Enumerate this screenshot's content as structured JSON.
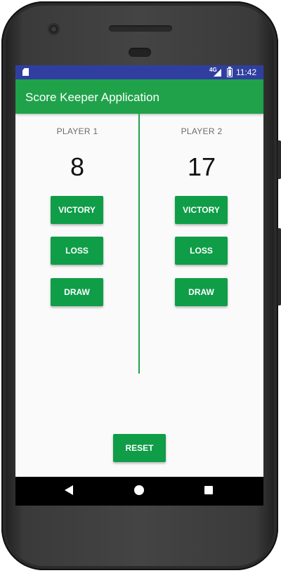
{
  "status_bar": {
    "network_label": "4G",
    "time": "11:42",
    "icons": [
      "sd-card-icon",
      "signal-icon",
      "battery-icon"
    ]
  },
  "app_bar": {
    "title": "Score Keeper Application"
  },
  "players": [
    {
      "name": "PLAYER 1",
      "score": "8"
    },
    {
      "name": "PLAYER 2",
      "score": "17"
    }
  ],
  "buttons": {
    "victory": "VICTORY",
    "loss": "LOSS",
    "draw": "DRAW",
    "reset": "RESET"
  },
  "navigation": {
    "icons": [
      "back-icon",
      "home-icon",
      "recents-icon"
    ]
  },
  "colors": {
    "status_bar": "#303f9f",
    "app_bar": "#20a24a",
    "button": "#0f9d48",
    "divider": "#22a34c"
  }
}
